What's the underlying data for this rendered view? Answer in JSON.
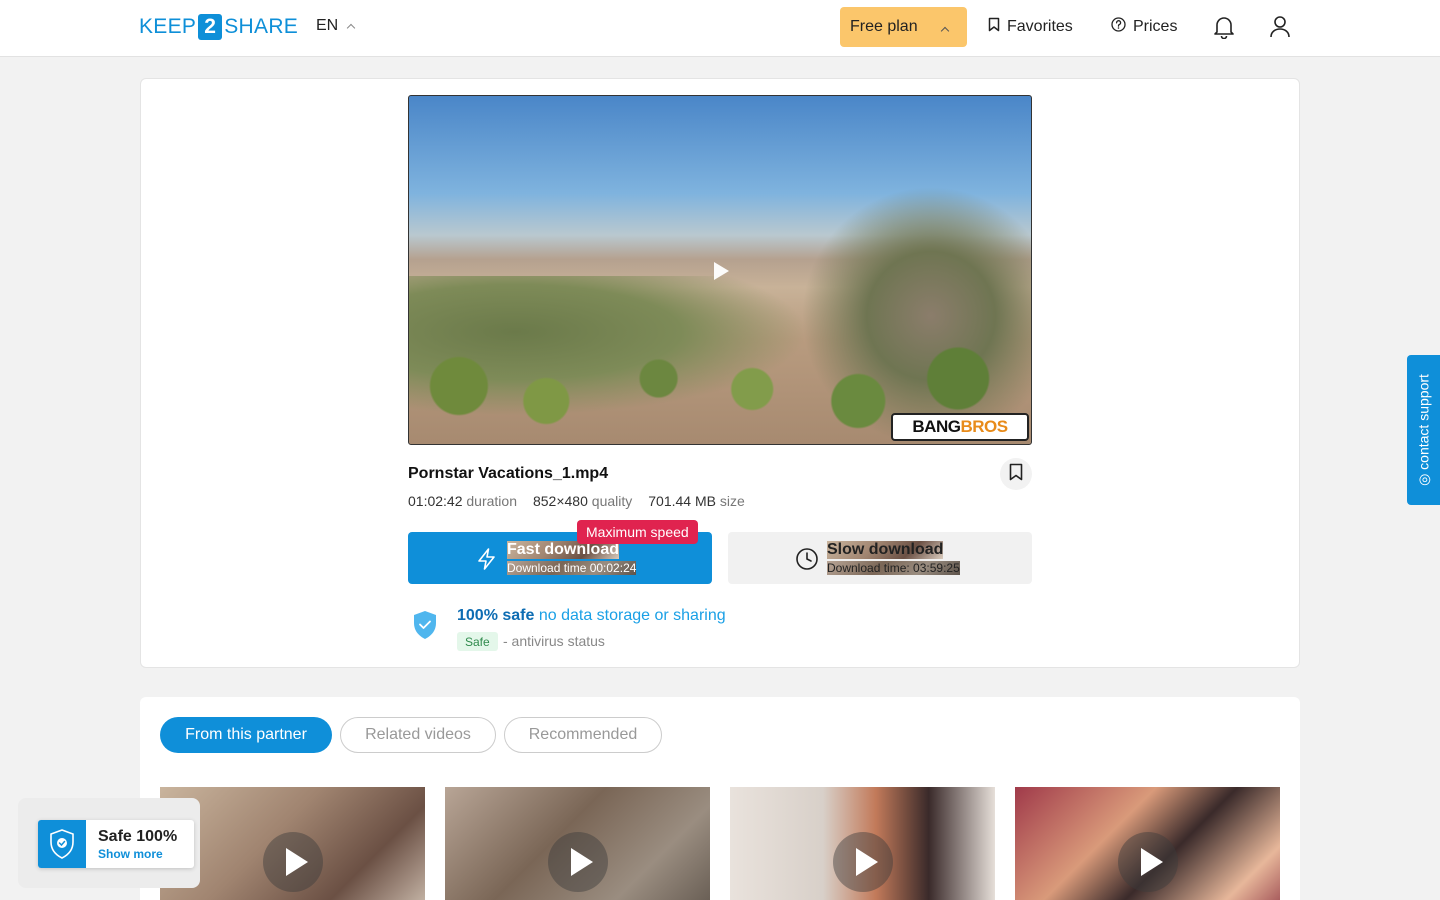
{
  "header": {
    "logo_left": "KEEP",
    "logo_mid": "2",
    "logo_right": "SHARE",
    "language": "EN",
    "plan_label": "Free plan",
    "favorites_label": "Favorites",
    "prices_label": "Prices"
  },
  "file": {
    "name": "Pornstar Vacations_1.mp4",
    "duration_value": "01:02:42",
    "duration_label": "duration",
    "quality_value": "852×480",
    "quality_label": "quality",
    "size_value": "701.44 MB",
    "size_label": "size",
    "watermark_left": "BANG",
    "watermark_right": "BROS"
  },
  "download": {
    "badge": "Maximum speed",
    "fast_title": "Fast download",
    "fast_sub": "Download time 00:02:24",
    "slow_title": "Slow download",
    "slow_sub": "Download time: 03:59:25"
  },
  "safety": {
    "bold": "100% safe",
    "normal": "no data storage or sharing",
    "badge": "Safe",
    "status_text": "- antivirus status"
  },
  "tabs": [
    {
      "label": "From this partner",
      "active": true
    },
    {
      "label": "Related videos",
      "active": false
    },
    {
      "label": "Recommended",
      "active": false
    }
  ],
  "widget": {
    "title": "Safe 100%",
    "link": "Show more"
  },
  "support": {
    "label": "◎ contact support"
  },
  "colors": {
    "accent": "#0f8fd9",
    "plan": "#fbc66b",
    "badge_red": "#e0234f"
  }
}
